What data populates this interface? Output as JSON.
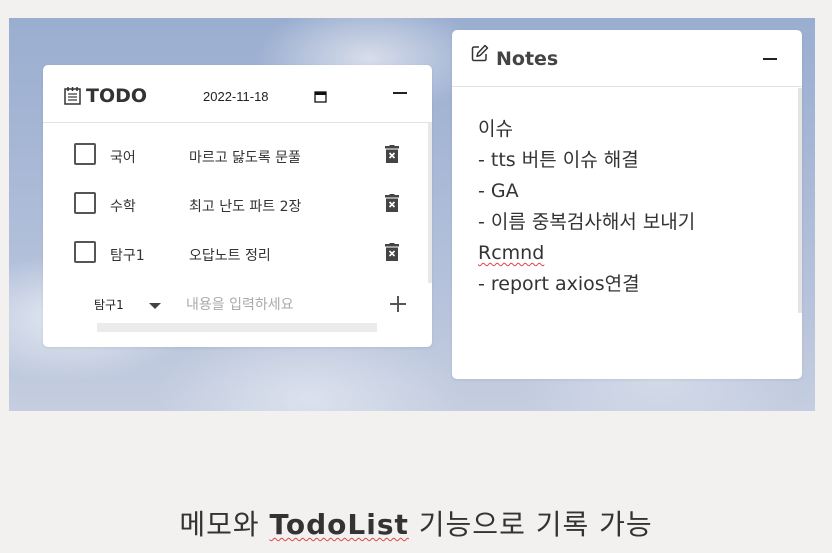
{
  "todo": {
    "title": "TODO",
    "date": "2022-11-18",
    "items": [
      {
        "subject": "국어",
        "content": "마르고 닳도록 문풀"
      },
      {
        "subject": "수학",
        "content": "최고 난도 파트 2장"
      },
      {
        "subject": "탐구1",
        "content": "오답노트 정리"
      }
    ],
    "add": {
      "selected_subject": "탐구1",
      "placeholder": "내용을 입력하세요"
    }
  },
  "notes": {
    "title": "Notes",
    "lines": [
      "이슈",
      "- tts 버튼 이슈 해결",
      "- GA",
      "- 이름 중복검사해서 보내기",
      "Rcmnd",
      "- report axios연결"
    ]
  },
  "caption": {
    "prefix": "메모와 ",
    "highlight": "TodoList",
    "suffix": " 기능으로 기록 가능"
  },
  "icons": {
    "todo": "notepad-icon",
    "calendar": "calendar-icon",
    "delete": "trash-icon",
    "add": "plus-icon",
    "notes": "edit-icon",
    "minimize": "minus-icon"
  }
}
